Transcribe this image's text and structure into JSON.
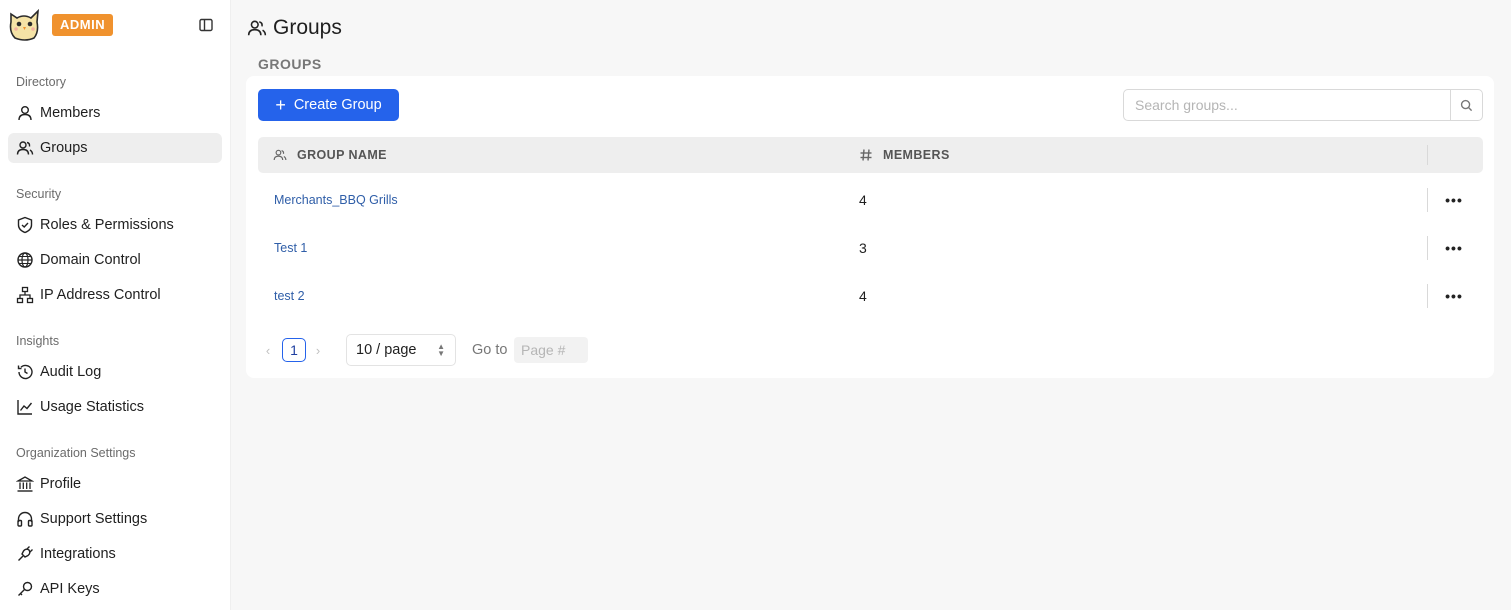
{
  "app": {
    "badge": "ADMIN"
  },
  "sidebar": {
    "sections": [
      {
        "label": "Directory"
      },
      {
        "label": "Security"
      },
      {
        "label": "Insights"
      },
      {
        "label": "Organization Settings"
      }
    ],
    "items": [
      {
        "label": "Members",
        "icon": "user-icon"
      },
      {
        "label": "Groups",
        "icon": "users-icon",
        "active": true
      },
      {
        "label": "Roles & Permissions",
        "icon": "shield-check-icon"
      },
      {
        "label": "Domain Control",
        "icon": "globe-icon"
      },
      {
        "label": "IP Address Control",
        "icon": "network-icon"
      },
      {
        "label": "Audit Log",
        "icon": "history-icon"
      },
      {
        "label": "Usage Statistics",
        "icon": "chart-line-icon"
      },
      {
        "label": "Profile",
        "icon": "building-icon"
      },
      {
        "label": "Support Settings",
        "icon": "headphones-icon"
      },
      {
        "label": "Integrations",
        "icon": "plug-icon"
      },
      {
        "label": "API Keys",
        "icon": "key-icon"
      }
    ]
  },
  "page": {
    "title": "Groups",
    "subtitle": "GROUPS",
    "create_label": "Create Group",
    "search_placeholder": "Search groups..."
  },
  "table": {
    "columns": [
      "GROUP NAME",
      "MEMBERS"
    ],
    "rows": [
      {
        "name": "Merchants_BBQ Grills",
        "members": "4"
      },
      {
        "name": "Test 1",
        "members": "3"
      },
      {
        "name": "test 2",
        "members": "4"
      }
    ]
  },
  "pagination": {
    "current_page": "1",
    "page_size": "10 / page",
    "goto_label": "Go to",
    "goto_placeholder": "Page #"
  },
  "colors": {
    "accent": "#2563eb",
    "badge": "#f0922e",
    "link": "#2f5ea8"
  }
}
